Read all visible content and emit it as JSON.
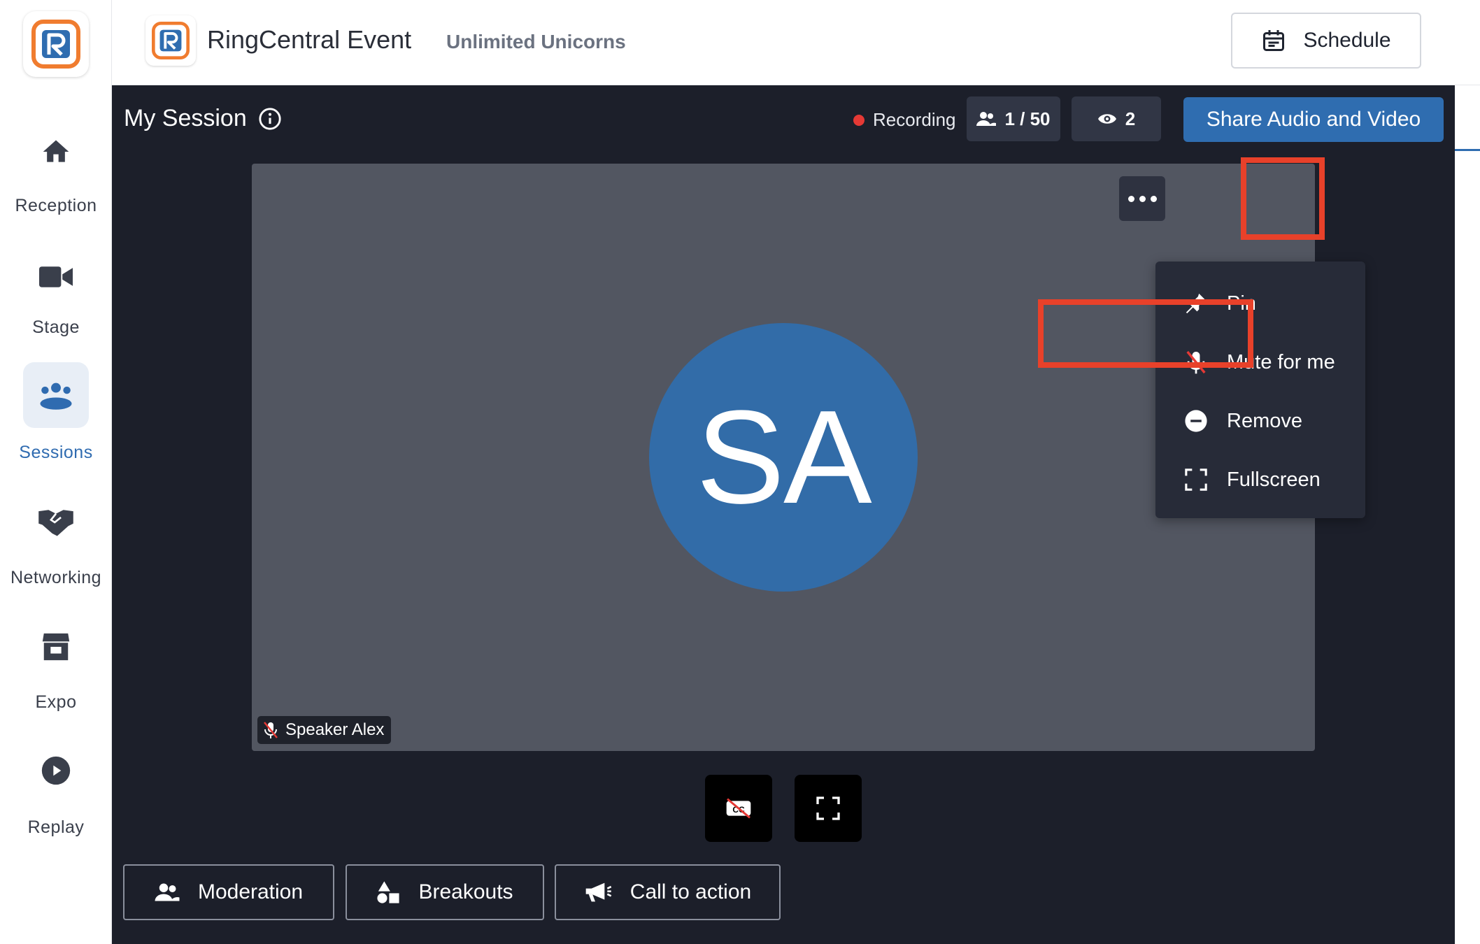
{
  "app": {
    "title": "RingCentral Event",
    "organization": "Unlimited Unicorns",
    "brand_color": "#f07c2f",
    "accent_color": "#2f6db0"
  },
  "sidebar": {
    "items": [
      {
        "label": "Reception",
        "icon": "home-icon",
        "active": false
      },
      {
        "label": "Stage",
        "icon": "video-camera-icon",
        "active": false
      },
      {
        "label": "Sessions",
        "icon": "group-icon",
        "active": true
      },
      {
        "label": "Networking",
        "icon": "handshake-icon",
        "active": false
      },
      {
        "label": "Expo",
        "icon": "booth-icon",
        "active": false
      },
      {
        "label": "Replay",
        "icon": "play-circle-icon",
        "active": false
      }
    ]
  },
  "header": {
    "schedule_label": "Schedule"
  },
  "session": {
    "title": "My Session",
    "recording_label": "Recording",
    "participants": "1 / 50",
    "viewers": "2",
    "share_label": "Share Audio and Video",
    "speaker": {
      "initials": "SA",
      "name": "Speaker Alex",
      "muted": true,
      "avatar_color": "#326ca8"
    }
  },
  "context_menu": {
    "items": [
      {
        "label": "Pin",
        "icon": "pin-icon"
      },
      {
        "label": "Mute for me",
        "icon": "mic-off-icon"
      },
      {
        "label": "Remove",
        "icon": "minus-circle-icon",
        "highlighted": true
      },
      {
        "label": "Fullscreen",
        "icon": "fullscreen-icon"
      }
    ]
  },
  "actions": {
    "moderation_label": "Moderation",
    "breakouts_label": "Breakouts",
    "call_to_action_label": "Call to action"
  },
  "highlight_color": "#e8412a"
}
